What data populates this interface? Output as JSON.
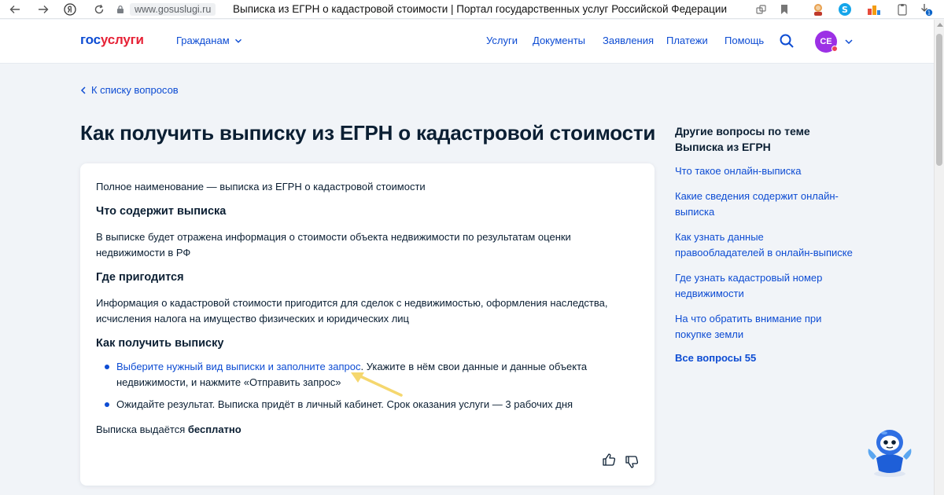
{
  "browser": {
    "url": "www.gosuslugi.ru",
    "title": "Выписка из ЕГРН о кадастровой стоимости | Портал государственных услуг Российской Федерации",
    "badge_count": "1"
  },
  "header": {
    "logo_part1": "гос",
    "logo_part2": "услуги",
    "citizens_label": "Гражданам",
    "nav": [
      "Услуги",
      "Документы",
      "Заявления",
      "Платежи",
      "Помощь"
    ],
    "avatar_initials": "СЕ"
  },
  "back_link": "К списку вопросов",
  "page_heading": "Как получить выписку из ЕГРН о кадастровой стоимости",
  "article": {
    "intro": "Полное наименование — выписка из ЕГРН о кадастровой стоимости",
    "section1_title": "Что содержит выписка",
    "section1_line1": "В выписке будет отражена информация о стоимости объекта недвижимости по результатам оценки",
    "section1_line2": "недвижимости в РФ",
    "section2_title": "Где пригодится",
    "section2_line1": "Информация о кадастровой стоимости пригодится для сделок с недвижимостью, оформления наследства,",
    "section2_line2": "исчисления налога на имущество физических и юридических лиц",
    "section3_title": "Как получить выписку",
    "step1_link": "Выберите нужный вид выписки и заполните запрос",
    "step1_rest": ". Укажите в нём свои данные и данные объекта",
    "step1_line2": "недвижимости, и нажмите «Отправить запрос»",
    "step2": "Ожидайте результат. Выписка придёт в личный кабинет. Срок оказания услуги — 3 рабочих дня",
    "free_prefix": "Выписка выдаётся ",
    "free_bold": "бесплатно"
  },
  "sidebar": {
    "title_line1": "Другие вопросы по теме",
    "title_line2": "Выписка из ЕГРН",
    "links": [
      {
        "line1": "Что такое онлайн-выписка",
        "line2": ""
      },
      {
        "line1": "Какие сведения содержит онлайн-",
        "line2": "выписка"
      },
      {
        "line1": "Как узнать данные",
        "line2": "правообладателей в онлайн-выписке"
      },
      {
        "line1": "Где узнать кадастровый номер",
        "line2": "недвижимости"
      },
      {
        "line1": "На что обратить внимание при",
        "line2": "покупке земли"
      }
    ],
    "all_questions": "Все вопросы 55"
  },
  "colors": {
    "accent": "#0d4cd3",
    "brand_red": "#e62236",
    "avatar": "#9c30e5",
    "arrow": "#f5d76e"
  }
}
